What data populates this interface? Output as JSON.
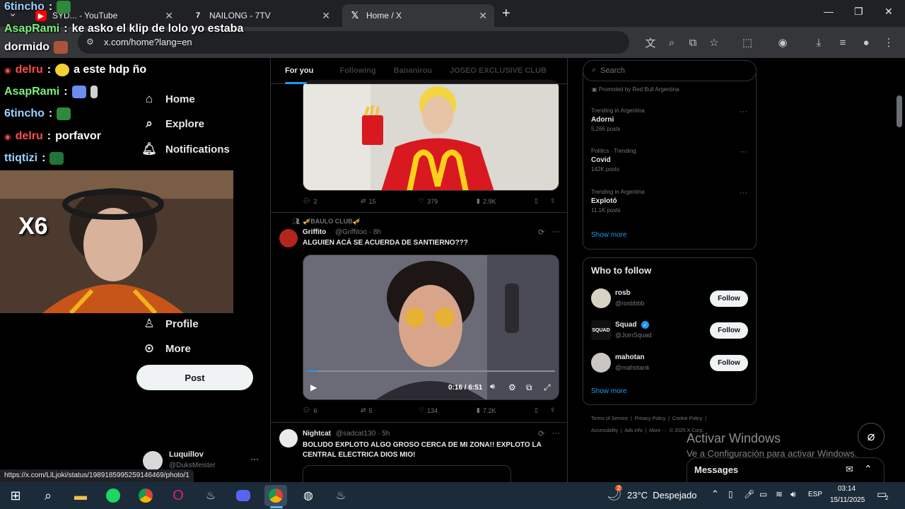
{
  "browser": {
    "tabs": [
      {
        "title": "SYD... - YouTube",
        "icon": "youtube-icon",
        "active": false
      },
      {
        "title": "NAILONG - 7TV",
        "icon": "7tv-icon",
        "active": false
      },
      {
        "title": "Home / X",
        "icon": "x-logo-icon",
        "active": true
      }
    ],
    "new_tab": "+",
    "url": "x.com/home?lang=en",
    "window_controls": {
      "minimize": "—",
      "restore": "❐",
      "close": "✕"
    }
  },
  "nav": {
    "home": "Home",
    "explore": "Explore",
    "notifications": "Notifications",
    "profile": "Profile",
    "more": "More",
    "post": "Post"
  },
  "account": {
    "name": "Luquillov",
    "handle": "@DuksMeister"
  },
  "status_url": "https://x.com/LlLjoki/status/1989185995259146469/photo/1",
  "feed": {
    "tabs": [
      "For you",
      "Following",
      "Bananirou",
      "JOSEO EXCLUSIVE CLUB"
    ],
    "tweet1": {
      "replies": "2",
      "retweets": "15",
      "likes": "379",
      "views": "2.9K"
    },
    "tweet2": {
      "community": "🎺BAULO CLUB🎺",
      "name": "Griffito",
      "handle": "@Griffitoo · 8h",
      "text": "ALGUIEN ACÁ SE ACUERDA DE SANTIERNO???",
      "video_time": "0:16 / 6:51",
      "replies": "6",
      "retweets": "5",
      "likes": "134",
      "views": "7.2K"
    },
    "tweet3": {
      "name": "Nightcat",
      "handle": "@sadcat130 · 5h",
      "text": "BOLUDO EXPLOTO ALGO GROSO CERCA DE MI ZONA!! EXPLOTO LA CENTRAL ELECTRICA DIOS MIO!"
    }
  },
  "right": {
    "search_placeholder": "Search",
    "promoted": "Promoted by Red Bull Argentina",
    "trends": [
      {
        "context": "Trending in Argentina",
        "topic": "Adorni",
        "posts": "5,266 posts"
      },
      {
        "context": "Politics · Trending",
        "topic": "Covid",
        "posts": "142K posts"
      },
      {
        "context": "Trending in Argentina",
        "topic": "Explotó",
        "posts": "11.1K posts"
      }
    ],
    "show_more": "Show more",
    "who_to_follow": "Who to follow",
    "follow_suggestions": [
      {
        "name": "rosb",
        "handle": "@rosbbbb",
        "verified": false
      },
      {
        "name": "Squad",
        "handle": "@JoinSquad",
        "verified": true
      },
      {
        "name": "mahotan",
        "handle": "@mahotank",
        "verified": false
      }
    ],
    "follow_label": "Follow",
    "footer_line1": "Terms of Service  |  Privacy Policy  |  Cookie Policy  |",
    "footer_line2": "Accessibility  |  Ads info  |  More ···  © 2025 X Corp.",
    "messages": "Messages"
  },
  "overlay": {
    "chat": [
      {
        "user": "6tincho",
        "sep": ":",
        "msg": ""
      },
      {
        "user": "AsapRami",
        "sep": ":",
        "msg": "ke asko el klip de lolo yo estaba"
      },
      {
        "user": "",
        "sep": "",
        "msg": "dormido"
      },
      {
        "user": "delru",
        "sep": ":",
        "msg": "a este hdp ño"
      },
      {
        "user": "AsapRami",
        "sep": ":",
        "msg": ""
      },
      {
        "user": "6tincho",
        "sep": ":",
        "msg": ""
      },
      {
        "user": "delru",
        "sep": ":",
        "msg": "porfavor"
      },
      {
        "user": "ttiqtizi",
        "sep": ":",
        "msg": ""
      }
    ],
    "cam_badge": "X6",
    "windows_watermark_title": "Activar Windows",
    "windows_watermark_sub": "Ve a Configuración para activar Windows."
  },
  "taskbar": {
    "weather": "23°C  Despejado",
    "weather_alert": "2",
    "lang": "ESP",
    "time": "03:14",
    "date": "15/11/2025",
    "notif_count": "2"
  },
  "colors": {
    "accent": "#1d9bf0",
    "chat_user_green": "#7cf07c",
    "chat_user_red": "#ff4d4d",
    "chat_user_blue": "#9bd3ff"
  }
}
